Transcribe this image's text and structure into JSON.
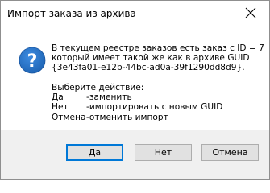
{
  "dialog": {
    "title": "Импорт заказа из архива",
    "message_lines": [
      "В текущем реестре заказов есть заказ с ID = 7",
      "который имеет такой же как в архиве GUID",
      "{3e43fa01-e12b-44bc-ad0a-39f1290dd8d9}."
    ],
    "prompt": "Выберите действие:",
    "options": [
      {
        "key": "Да",
        "desc": "-заменить"
      },
      {
        "key": "Нет",
        "desc": "-импортировать с новым GUID"
      },
      {
        "key": "Отмена",
        "desc": "-отменить импорт"
      }
    ],
    "icon": "question-icon",
    "buttons": {
      "yes": "Да",
      "no": "Нет",
      "cancel": "Отмена"
    }
  },
  "colors": {
    "icon_blue": "#1e64b4",
    "footer_bg": "#f0f0f0",
    "default_button_border": "#0078d7"
  }
}
